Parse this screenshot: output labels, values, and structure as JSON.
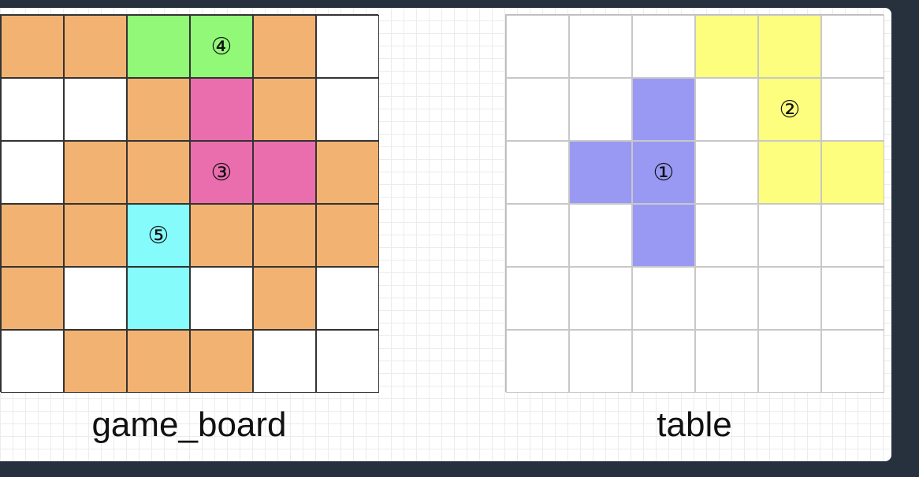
{
  "colors": {
    "O": "#f2b272",
    "W": "#ffffff",
    "G": "#92f978",
    "P": "#ea6eae",
    "C": "#86fbfb",
    "B": "#9999f4",
    "Y": "#fdfd7e"
  },
  "game_board": {
    "label": "game_board",
    "rows": [
      [
        "O",
        "O",
        "G",
        "G",
        "O",
        "W"
      ],
      [
        "W",
        "W",
        "O",
        "P",
        "O",
        "W"
      ],
      [
        "W",
        "O",
        "O",
        "P",
        "P",
        "O"
      ],
      [
        "O",
        "O",
        "C",
        "O",
        "O",
        "O"
      ],
      [
        "O",
        "W",
        "C",
        "W",
        "O",
        "W"
      ],
      [
        "W",
        "O",
        "O",
        "O",
        "W",
        "W"
      ]
    ],
    "marks": [
      {
        "row": 0,
        "col": 3,
        "text": "④"
      },
      {
        "row": 2,
        "col": 3,
        "text": "③"
      },
      {
        "row": 3,
        "col": 2,
        "text": "⑤"
      }
    ]
  },
  "table": {
    "label": "table",
    "rows": [
      [
        "W",
        "W",
        "W",
        "Y",
        "Y",
        "W"
      ],
      [
        "W",
        "W",
        "B",
        "W",
        "Y",
        "W"
      ],
      [
        "W",
        "B",
        "B",
        "W",
        "Y",
        "Y"
      ],
      [
        "W",
        "W",
        "B",
        "W",
        "W",
        "W"
      ],
      [
        "W",
        "W",
        "W",
        "W",
        "W",
        "W"
      ],
      [
        "W",
        "W",
        "W",
        "W",
        "W",
        "W"
      ]
    ],
    "marks": [
      {
        "row": 1,
        "col": 4,
        "text": "②"
      },
      {
        "row": 2,
        "col": 2,
        "text": "①"
      }
    ]
  }
}
